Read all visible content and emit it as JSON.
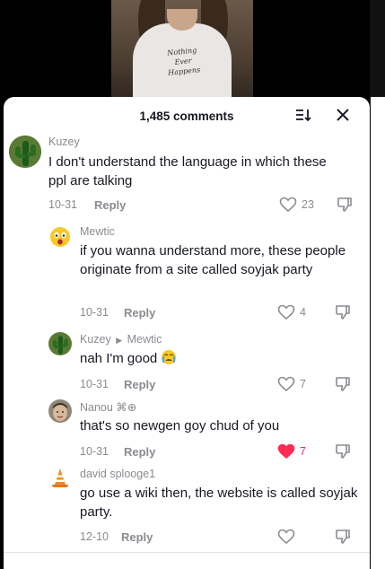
{
  "video": {
    "shirt_text": [
      "Nothing",
      "Ever",
      "Happens"
    ]
  },
  "header": {
    "comment_count": "1,485 comments",
    "sort_icon": "sort-icon",
    "close_icon": "close-icon"
  },
  "comments": [
    {
      "username": "Kuzey",
      "text": "I don't understand the language in which these ppl are talking",
      "date": "10-31",
      "reply_label": "Reply",
      "likes": "23",
      "liked": false,
      "avatar": "cactus-avatar"
    },
    {
      "username": "Mewtic",
      "text": "if you wanna understand more, these people originate from a site called soyjak party",
      "date": "10-31",
      "reply_label": "Reply",
      "likes": "4",
      "liked": false,
      "avatar": "shocked-emoji-avatar"
    },
    {
      "username": "Kuzey",
      "reply_to": "Mewtic",
      "text": "nah I'm good",
      "date": "10-31",
      "reply_label": "Reply",
      "likes": "7",
      "liked": false,
      "avatar": "cactus-avatar"
    },
    {
      "username": "Nanou ⌘⊕",
      "text": "that's so newgen goy chud of you",
      "date": "10-31",
      "reply_label": "Reply",
      "likes": "7",
      "liked": true,
      "avatar": "face-avatar"
    },
    {
      "username": "david splooge1",
      "text": "go use a wiki then, the website is called soyjak party.",
      "date": "12-10",
      "reply_label": "Reply",
      "likes": "",
      "liked": false,
      "avatar": "traffic-cone-avatar"
    }
  ],
  "colors": {
    "liked": "#fe2c55",
    "muted": "#8a8b91",
    "text": "#161823"
  }
}
